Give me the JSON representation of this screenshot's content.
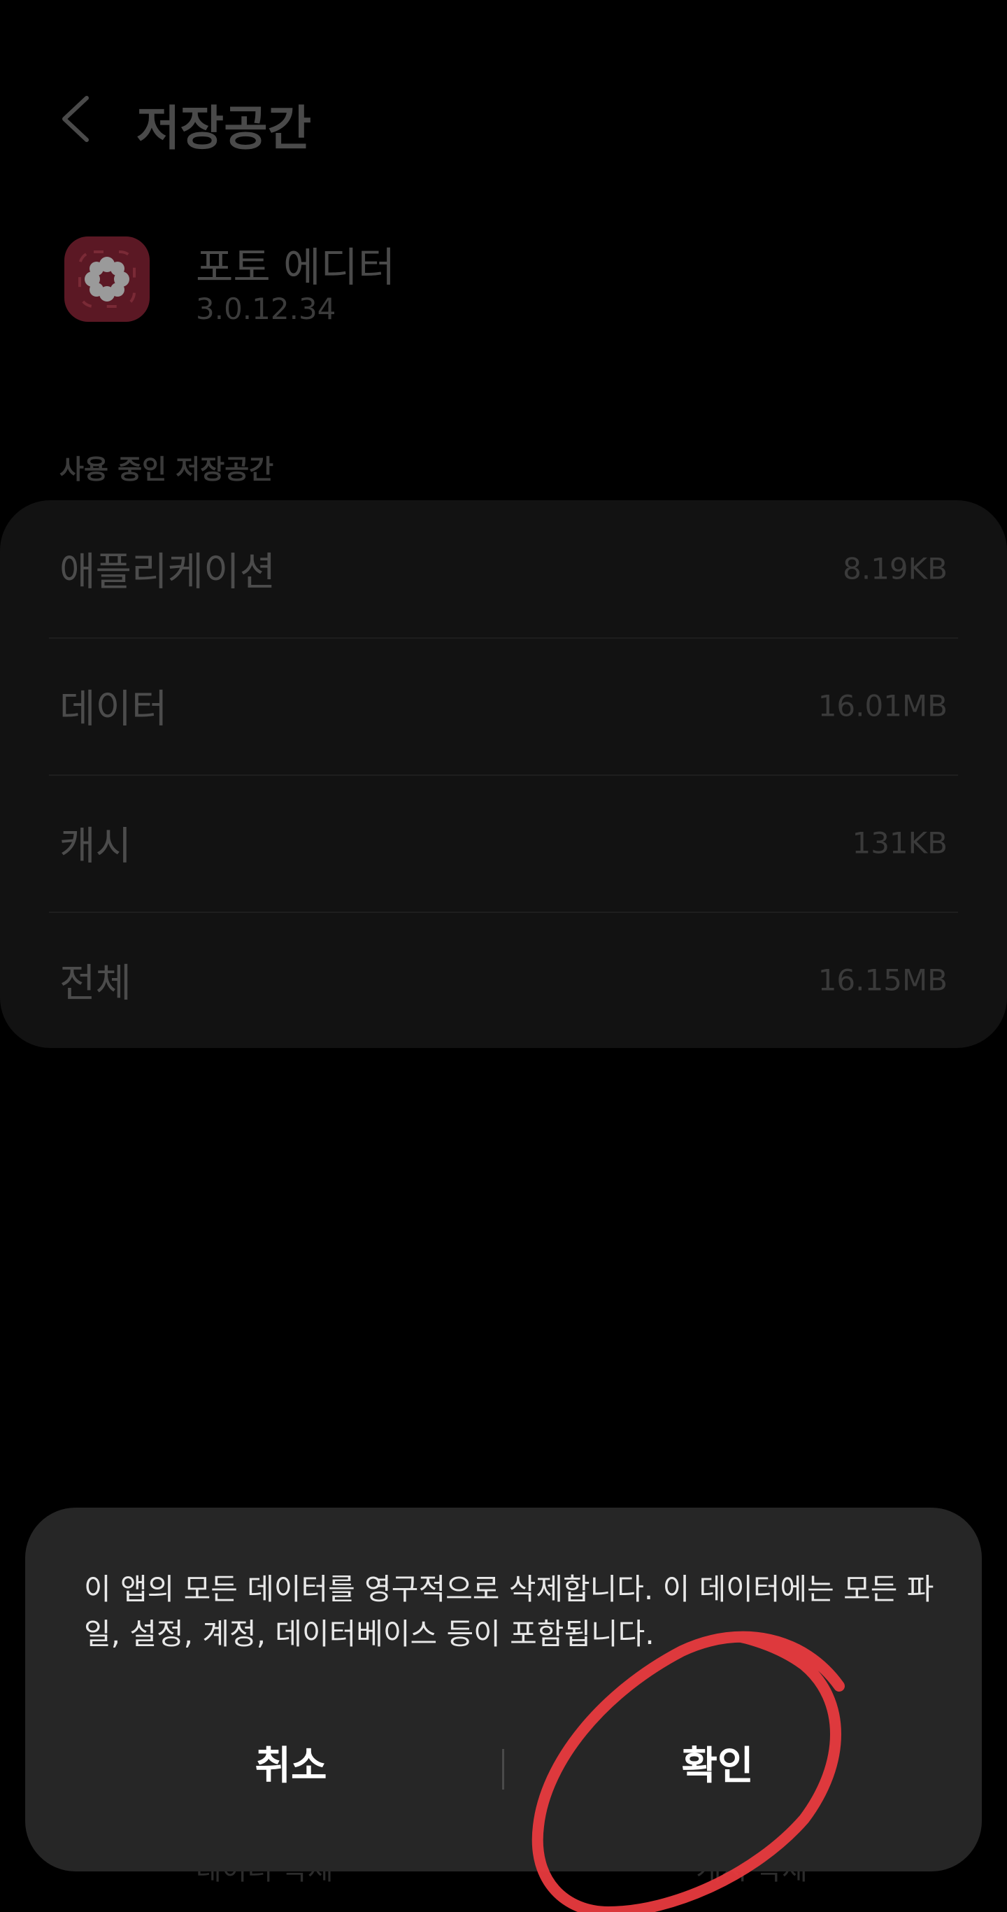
{
  "header": {
    "title": "저장공간"
  },
  "app": {
    "name": "포토 에디터",
    "version": "3.0.12.34"
  },
  "storage": {
    "section_label": "사용 중인 저장공간",
    "rows": [
      {
        "label": "애플리케이션",
        "value": "8.19KB"
      },
      {
        "label": "데이터",
        "value": "16.01MB"
      },
      {
        "label": "캐시",
        "value": "131KB"
      },
      {
        "label": "전체",
        "value": "16.15MB"
      }
    ]
  },
  "bottom_bar": {
    "left_label": "데이터 삭제",
    "right_label": "캐시 삭제"
  },
  "dialog": {
    "message": "이 앱의 모든 데이터를 영구적으로 삭제합니다. 이 데이터에는 모든 파일, 설정, 계정, 데이터베이스 등이 포함됩니다.",
    "cancel_label": "취소",
    "confirm_label": "확인"
  },
  "colors": {
    "accent_annotation": "#e83a3e",
    "dialog_bg": "#262626",
    "card_bg": "#121212"
  },
  "icons": {
    "back": "chevron-left-icon",
    "app": "flower-icon"
  }
}
